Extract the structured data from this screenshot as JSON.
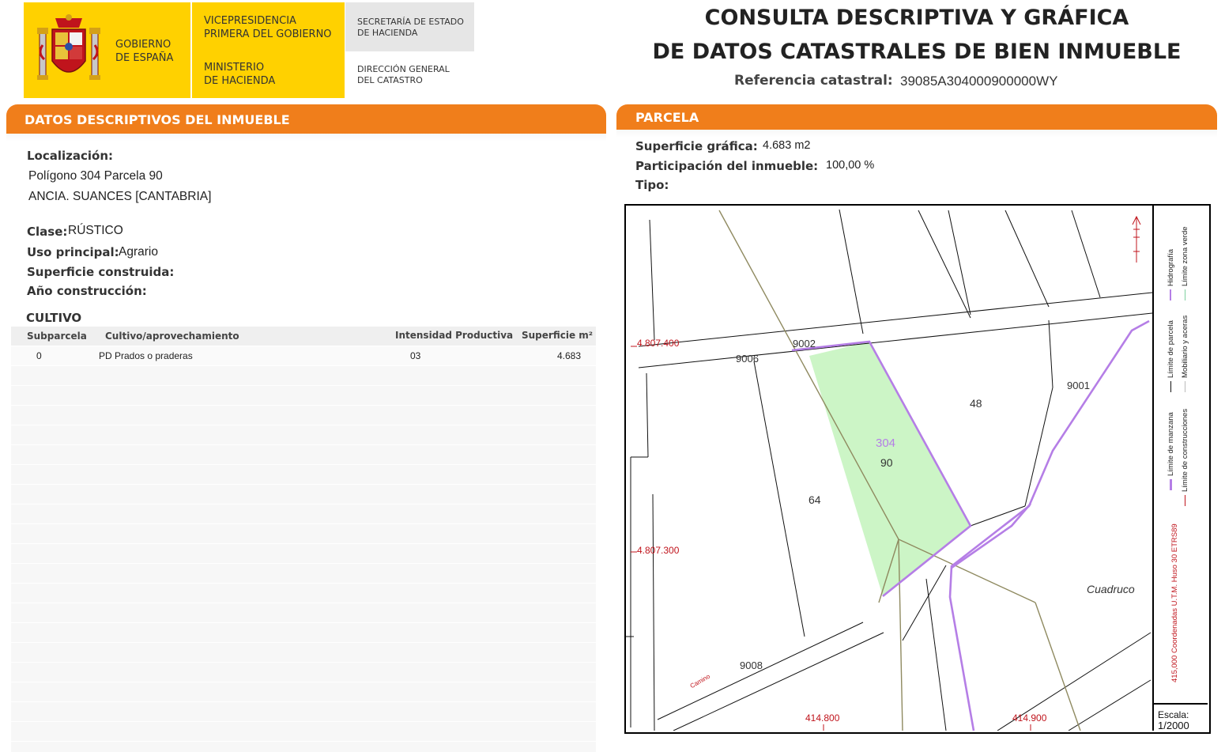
{
  "header": {
    "gov_name_line1": "GOBIERNO",
    "gov_name_line2": "DE ESPAÑA",
    "vice_line1": "VICEPRESIDENCIA",
    "vice_line2": "PRIMERA DEL GOBIERNO",
    "ministry_line1": "MINISTERIO",
    "ministry_line2": "DE HACIENDA",
    "secretaria_line1": "SECRETARÍA DE ESTADO",
    "secretaria_line2": "DE HACIENDA",
    "direccion_line1": "DIRECCIÓN GENERAL",
    "direccion_line2": "DEL CATASTRO",
    "title_line1": "CONSULTA DESCRIPTIVA Y GRÁFICA",
    "title_line2": "DE DATOS CATASTRALES DE BIEN INMUEBLE",
    "ref_label": "Referencia catastral:",
    "ref_value": "39085A304000900000WY"
  },
  "left": {
    "banner": "DATOS DESCRIPTIVOS DEL INMUEBLE",
    "localizacion_label": "Localización:",
    "localizacion_line1": "Polígono 304 Parcela 90",
    "localizacion_line2": "ANCIA. SUANCES [CANTABRIA]",
    "clase_label": "Clase:",
    "clase_value": "RÚSTICO",
    "uso_label": "Uso principal:",
    "uso_value": "Agrario",
    "superficie_label": "Superficie construida:",
    "anio_label": "Año construcción:",
    "cultivo_title": "CULTIVO",
    "table": {
      "headers": [
        "Subparcela",
        "Cultivo/aprovechamiento",
        "Intensidad Productiva",
        "Superficie m²"
      ],
      "rows": [
        {
          "subparcela": "0",
          "cultivo": "PD Prados o praderas",
          "intensidad": "03",
          "superficie": "4.683"
        }
      ]
    }
  },
  "right": {
    "banner": "PARCELA",
    "sup_label": "Superficie gráfica:",
    "sup_value": "4.683 m2",
    "part_label": "Participación del inmueble:",
    "part_value": "100,00 %",
    "tipo_label": "Tipo:",
    "map": {
      "coord_y_top": "4.807.400",
      "coord_y_bottom": "4.807.300",
      "coord_x_left": "414.800",
      "coord_x_right": "414.900",
      "label_9002": "9002",
      "label_9006": "9006",
      "label_9001": "9001",
      "label_9008": "9008",
      "label_48": "48",
      "label_64": "64",
      "label_304": "304",
      "label_90": "90",
      "label_cuadruco": "Cuadruco",
      "label_camino": "Camino",
      "escala_label": "Escala:",
      "escala_value": "1/2000",
      "coords_note": "415,000 Coordenadas U.T.M. Huso 30 ETRS89",
      "legend": {
        "manzana": "Límite de manzana",
        "parcela": "Límite de parcela",
        "hidrografia": "Hidrografía",
        "construcciones": "Límite de construcciones",
        "mobiliario": "Mobiliario y aceras",
        "zona_verde": "Límite zona verde"
      },
      "colors": {
        "parcel_fill": "#ccf5c6",
        "hydrography": "#b57ee6",
        "coordinates": "#c0141c",
        "path_line": "#8f8a60"
      }
    }
  }
}
